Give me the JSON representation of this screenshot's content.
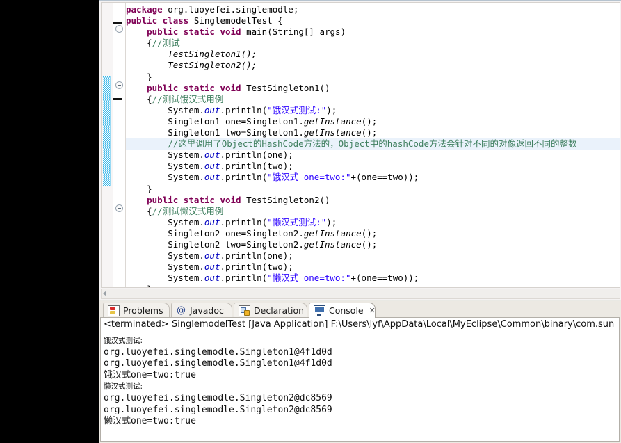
{
  "editor": {
    "gutter_icon": "fold-collapse-icon",
    "lines": [
      [
        {
          "t": "package ",
          "c": "kw"
        },
        {
          "t": "org.luoyefei.singlemodle;",
          "c": ""
        }
      ],
      [
        {
          "t": "public class ",
          "c": "kw"
        },
        {
          "t": "SinglemodelTest {",
          "c": ""
        }
      ],
      [
        {
          "t": "    ",
          "c": ""
        },
        {
          "t": "public static void ",
          "c": "kw"
        },
        {
          "t": "main(String[] args)",
          "c": ""
        }
      ],
      [
        {
          "t": "    {",
          "c": ""
        },
        {
          "t": "//测试",
          "c": "cmt"
        }
      ],
      [
        {
          "t": "        ",
          "c": ""
        },
        {
          "t": "TestSingleton1();",
          "c": "mth"
        }
      ],
      [
        {
          "t": "        ",
          "c": ""
        },
        {
          "t": "TestSingleton2();",
          "c": "mth"
        }
      ],
      [
        {
          "t": "    }",
          "c": ""
        }
      ],
      [
        {
          "t": "    ",
          "c": ""
        },
        {
          "t": "public static void ",
          "c": "kw"
        },
        {
          "t": "TestSingleton1()",
          "c": ""
        }
      ],
      [
        {
          "t": "    {",
          "c": ""
        },
        {
          "t": "//测试饿汉式用例",
          "c": "cmt"
        }
      ],
      [
        {
          "t": "        System.",
          "c": ""
        },
        {
          "t": "out",
          "c": "fld"
        },
        {
          "t": ".println(",
          "c": ""
        },
        {
          "t": "\"饿汉式测试:\"",
          "c": "str"
        },
        {
          "t": ");",
          "c": ""
        }
      ],
      [
        {
          "t": "        Singleton1 one=Singleton1.",
          "c": ""
        },
        {
          "t": "getInstance",
          "c": "mth"
        },
        {
          "t": "();",
          "c": ""
        }
      ],
      [
        {
          "t": "        Singleton1 two=Singleton1.",
          "c": ""
        },
        {
          "t": "getInstance",
          "c": "mth"
        },
        {
          "t": "();",
          "c": ""
        }
      ],
      [
        {
          "t": "        //这里调用了Object的HashCode方法的，Object中的hashCode方法会针对不同的对像返回不同的整数",
          "c": "cmt"
        }
      ],
      [
        {
          "t": "        System.",
          "c": ""
        },
        {
          "t": "out",
          "c": "fld"
        },
        {
          "t": ".println(one);",
          "c": ""
        }
      ],
      [
        {
          "t": "        System.",
          "c": ""
        },
        {
          "t": "out",
          "c": "fld"
        },
        {
          "t": ".println(two);",
          "c": ""
        }
      ],
      [
        {
          "t": "        System.",
          "c": ""
        },
        {
          "t": "out",
          "c": "fld"
        },
        {
          "t": ".println(",
          "c": ""
        },
        {
          "t": "\"饿汉式 one=two:\"",
          "c": "str"
        },
        {
          "t": "+(one==two));",
          "c": ""
        }
      ],
      [
        {
          "t": "    }",
          "c": ""
        }
      ],
      [
        {
          "t": "    ",
          "c": ""
        },
        {
          "t": "public static void ",
          "c": "kw"
        },
        {
          "t": "TestSingleton2()",
          "c": ""
        }
      ],
      [
        {
          "t": "    {",
          "c": ""
        },
        {
          "t": "//测试懒汉式用例",
          "c": "cmt"
        }
      ],
      [
        {
          "t": "        System.",
          "c": ""
        },
        {
          "t": "out",
          "c": "fld"
        },
        {
          "t": ".println(",
          "c": ""
        },
        {
          "t": "\"懒汉式测试:\"",
          "c": "str"
        },
        {
          "t": ");",
          "c": ""
        }
      ],
      [
        {
          "t": "        Singleton2 one=Singleton2.",
          "c": ""
        },
        {
          "t": "getInstance",
          "c": "mth"
        },
        {
          "t": "();",
          "c": ""
        }
      ],
      [
        {
          "t": "        Singleton2 two=Singleton2.",
          "c": ""
        },
        {
          "t": "getInstance",
          "c": "mth"
        },
        {
          "t": "();",
          "c": ""
        }
      ],
      [
        {
          "t": "        System.",
          "c": ""
        },
        {
          "t": "out",
          "c": "fld"
        },
        {
          "t": ".println(one);",
          "c": ""
        }
      ],
      [
        {
          "t": "        System.",
          "c": ""
        },
        {
          "t": "out",
          "c": "fld"
        },
        {
          "t": ".println(two);",
          "c": ""
        }
      ],
      [
        {
          "t": "        System.",
          "c": ""
        },
        {
          "t": "out",
          "c": "fld"
        },
        {
          "t": ".println(",
          "c": ""
        },
        {
          "t": "\"懒汉式 one=two:\"",
          "c": "str"
        },
        {
          "t": "+(one==two));",
          "c": ""
        }
      ],
      [
        {
          "t": "    }",
          "c": ""
        }
      ]
    ],
    "highlighted_line_index": 12,
    "colors": {
      "keyword": "#7f0055",
      "string": "#2a00ff",
      "comment": "#3f7f5f",
      "field": "#0000c0",
      "highlight_row": "#eaf2fb",
      "occurrence_marker": "#33b6e8"
    }
  },
  "bottom_panel": {
    "tabs": [
      {
        "label": "Problems",
        "icon": "problems-icon",
        "active": false,
        "closable": false
      },
      {
        "label": "Javadoc",
        "icon": "javadoc-icon",
        "active": false,
        "closable": false
      },
      {
        "label": "Declaration",
        "icon": "declaration-icon",
        "active": false,
        "closable": false
      },
      {
        "label": "Console",
        "icon": "console-icon",
        "active": true,
        "closable": true,
        "close_glyph": "✕"
      }
    ],
    "console": {
      "terminated_line": "<terminated> SinglemodelTest [Java Application] F:\\Users\\lyf\\AppData\\Local\\MyEclipse\\Common\\binary\\com.sun",
      "output": [
        {
          "text": "饿汉式测试:",
          "cjk": true
        },
        {
          "text": "org.luoyefei.singlemodle.Singleton1@4f1d0d",
          "cjk": false
        },
        {
          "text": "org.luoyefei.singlemodle.Singleton1@4f1d0d",
          "cjk": false
        },
        {
          "text": "饿汉式one=two:true",
          "cjk": false
        },
        {
          "text": "懒汉式测试:",
          "cjk": true
        },
        {
          "text": "org.luoyefei.singlemodle.Singleton2@dc8569",
          "cjk": false
        },
        {
          "text": "org.luoyefei.singlemodle.Singleton2@dc8569",
          "cjk": false
        },
        {
          "text": "懒汉式one=two:true",
          "cjk": false
        }
      ]
    }
  },
  "scrollbar": {
    "arrow_icon": "scroll-left-arrow-icon"
  }
}
